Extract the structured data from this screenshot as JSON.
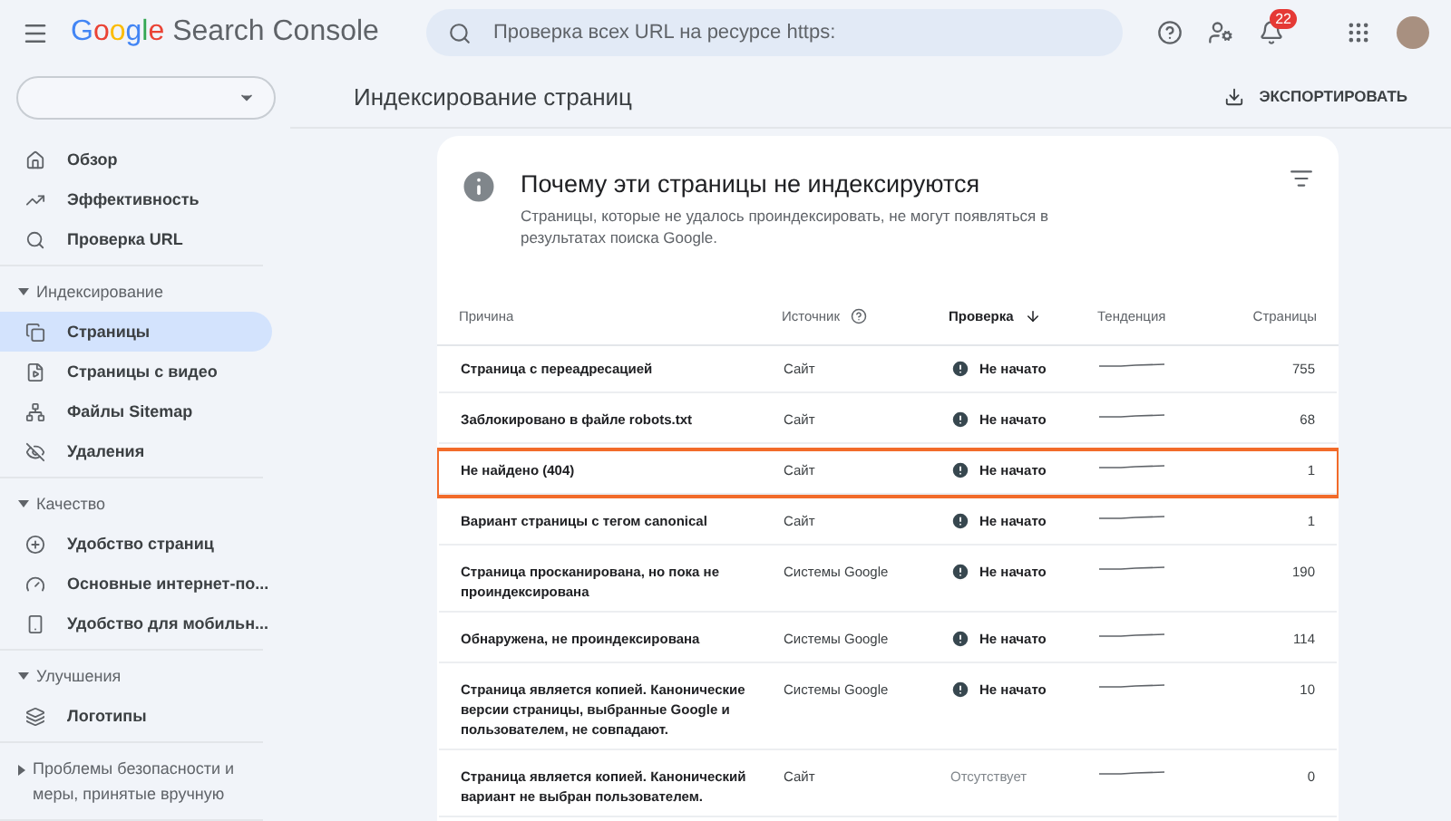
{
  "header": {
    "logo_brand": "Google",
    "logo_product": "Search Console",
    "search": {
      "placeholder": "Проверка всех URL на ресурсе https:"
    },
    "notifications": "22"
  },
  "sidebar": {
    "sections": [
      {
        "items": [
          {
            "label": "Обзор",
            "selected": false
          },
          {
            "label": "Эффективность",
            "selected": false
          },
          {
            "label": "Проверка URL",
            "selected": false
          }
        ]
      },
      {
        "title": "Индексирование",
        "expanded": true,
        "items": [
          {
            "label": "Страницы",
            "selected": true
          },
          {
            "label": "Страницы с видео",
            "selected": false
          },
          {
            "label": "Файлы Sitemap",
            "selected": false
          },
          {
            "label": "Удаления",
            "selected": false
          }
        ]
      },
      {
        "title": "Качество",
        "expanded": true,
        "items": [
          {
            "label": "Удобство страниц",
            "selected": false
          },
          {
            "label": "Основные интернет-по...",
            "selected": false
          },
          {
            "label": "Удобство для мобильн...",
            "selected": false
          }
        ]
      },
      {
        "title": "Улучшения",
        "expanded": true,
        "items": [
          {
            "label": "Логотипы",
            "selected": false
          }
        ]
      },
      {
        "title": "Проблемы безопасности и меры, принятые вручную",
        "expanded": false
      }
    ]
  },
  "page": {
    "title": "Индексирование страниц",
    "export_button": "ЭКСПОРТИРОВАТЬ"
  },
  "card": {
    "title": "Почему эти страницы не индексируются",
    "description": "Страницы, которые не удалось проиндексировать, не могут появляться в результатах поиска Google.",
    "columns": [
      {
        "label": "Причина",
        "sorted": false
      },
      {
        "label": "Источник",
        "sorted": false
      },
      {
        "label": "Проверка",
        "sorted": true
      },
      {
        "label": "Тенденция",
        "sorted": false
      },
      {
        "label": "Страницы",
        "sorted": false
      }
    ],
    "rows": [
      {
        "reason": "Страница с переадресацией",
        "source": "Сайт",
        "validation": {
          "kind": "not_started",
          "label": "Не начато"
        },
        "pages": "755",
        "highlighted": false
      },
      {
        "reason": "Заблокировано в файле robots.txt",
        "source": "Сайт",
        "validation": {
          "kind": "not_started",
          "label": "Не начато"
        },
        "pages": "68",
        "highlighted": false
      },
      {
        "reason": "Не найдено (404)",
        "source": "Сайт",
        "validation": {
          "kind": "not_started",
          "label": "Не начато"
        },
        "pages": "1",
        "highlighted": true
      },
      {
        "reason": "Вариант страницы с тегом canonical",
        "source": "Сайт",
        "validation": {
          "kind": "not_started",
          "label": "Не начато"
        },
        "pages": "1",
        "highlighted": false
      },
      {
        "reason": "Страница просканирована, но пока не проиндексирована",
        "source": "Системы Google",
        "validation": {
          "kind": "not_started",
          "label": "Не начато"
        },
        "pages": "190",
        "highlighted": false
      },
      {
        "reason": "Обнаружена, не проиндексирована",
        "source": "Системы Google",
        "validation": {
          "kind": "not_started",
          "label": "Не начато"
        },
        "pages": "114",
        "highlighted": false
      },
      {
        "reason": "Страница является копией. Канонические версии страницы, выбранные Google и пользователем, не совпадают.",
        "source": "Системы Google",
        "validation": {
          "kind": "not_started",
          "label": "Не начато"
        },
        "pages": "10",
        "highlighted": false
      },
      {
        "reason": "Страница является копией. Канонический вариант не выбран пользователем.",
        "source": "Сайт",
        "validation": {
          "kind": "absent",
          "label": "Отсутствует"
        },
        "pages": "0",
        "highlighted": false
      }
    ]
  }
}
